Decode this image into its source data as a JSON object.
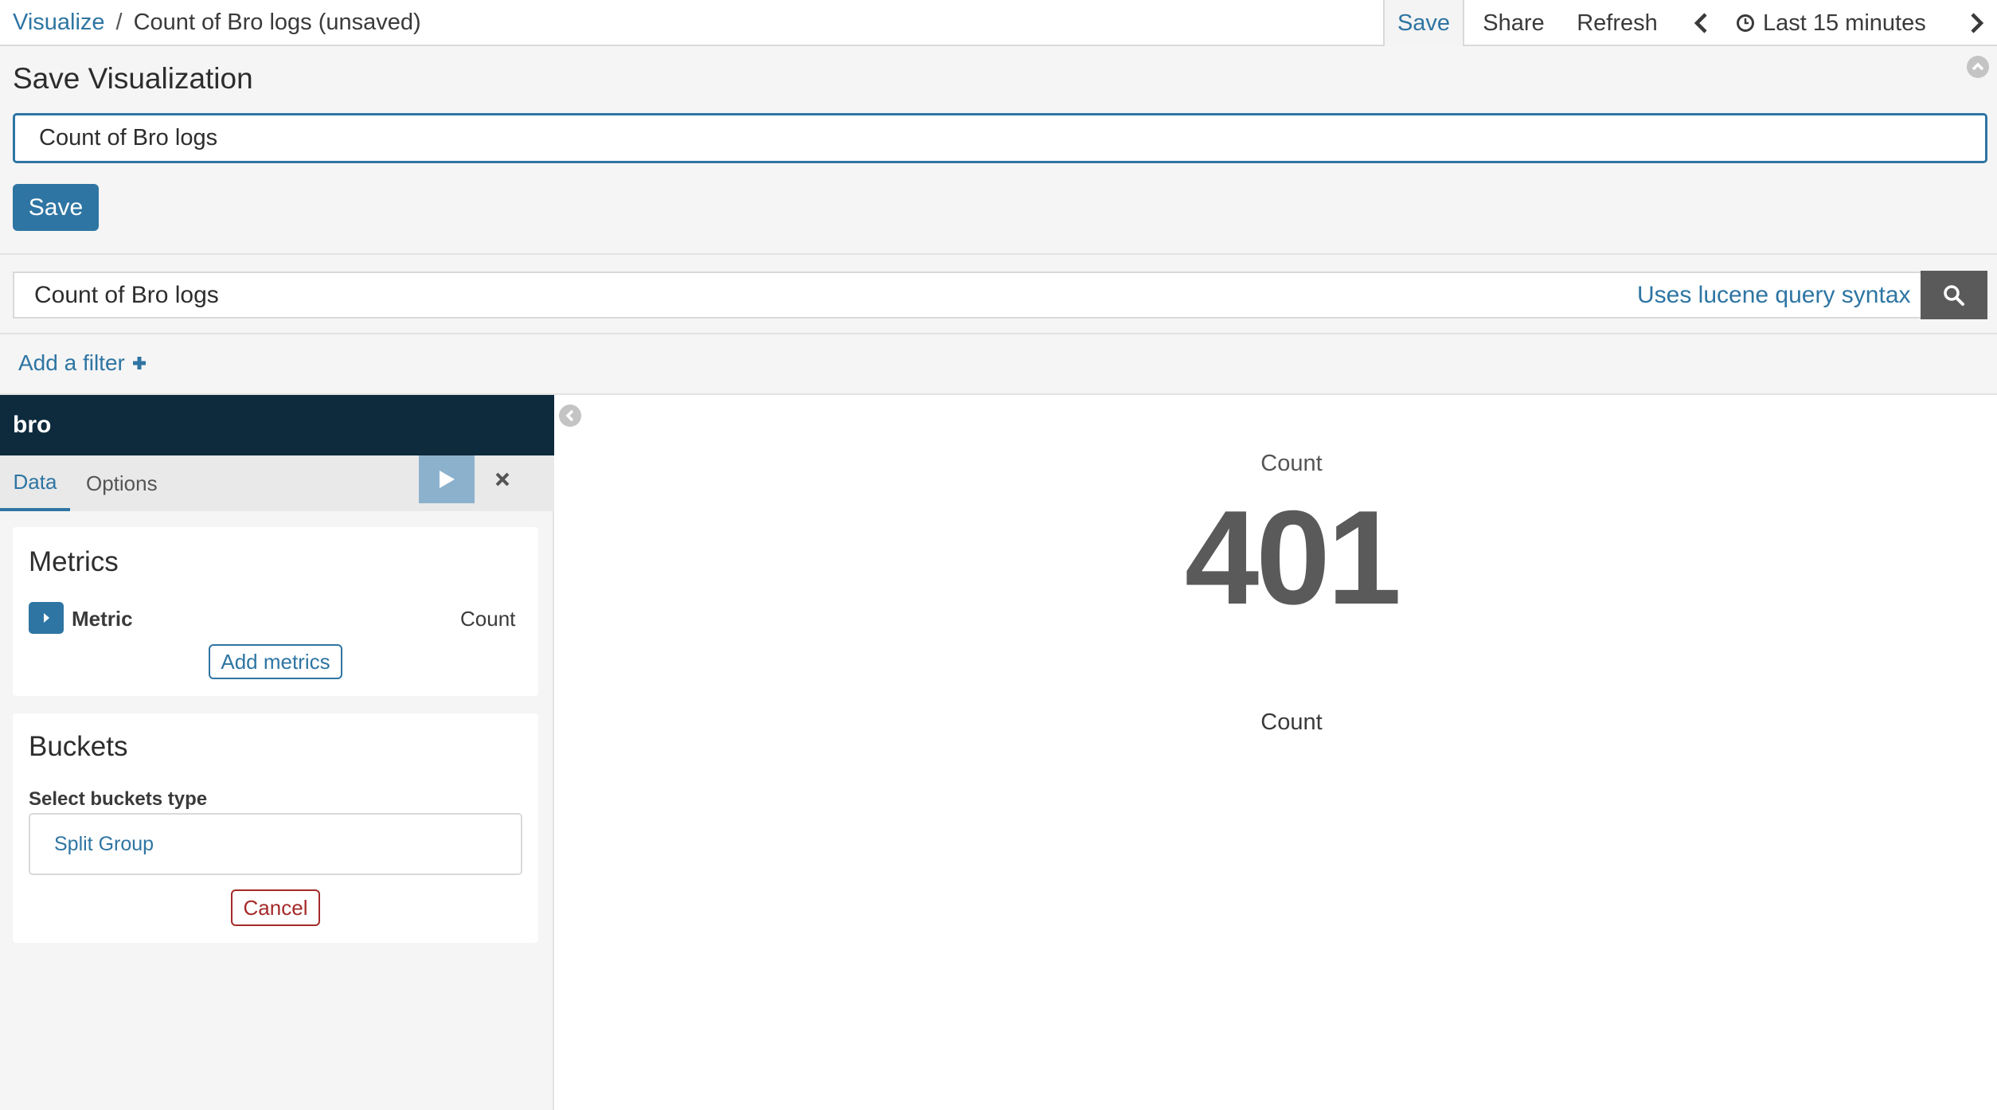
{
  "breadcrumb": {
    "root": "Visualize",
    "separator": "/",
    "current": "Count of Bro logs (unsaved)"
  },
  "topnav": {
    "save": "Save",
    "share": "Share",
    "refresh": "Refresh",
    "time_range": "Last 15 minutes",
    "prev_icon": "chevron-left-icon",
    "next_icon": "chevron-right-icon",
    "clock_icon": "clock-icon"
  },
  "save_panel": {
    "title": "Save Visualization",
    "name_value": "Count of Bro logs",
    "save_button": "Save"
  },
  "query": {
    "value": "Count of Bro logs",
    "syntax_link": "Uses lucene query syntax",
    "search_icon": "search-icon"
  },
  "filters": {
    "add_filter": "Add a filter"
  },
  "sidebar": {
    "index_pattern": "bro",
    "tabs": [
      "Data",
      "Options"
    ],
    "metrics": {
      "title": "Metrics",
      "item_label": "Metric",
      "item_agg": "Count",
      "add_button": "Add metrics"
    },
    "buckets": {
      "title": "Buckets",
      "type_label": "Select buckets type",
      "option": "Split Group",
      "cancel": "Cancel"
    }
  },
  "visualization": {
    "title": "Count",
    "value": "401",
    "label": "Count"
  },
  "colors": {
    "accent": "#2e75a3",
    "header_dark": "#0e2a3d",
    "danger": "#a52a2a",
    "metric_value": "#5a5a5a"
  }
}
